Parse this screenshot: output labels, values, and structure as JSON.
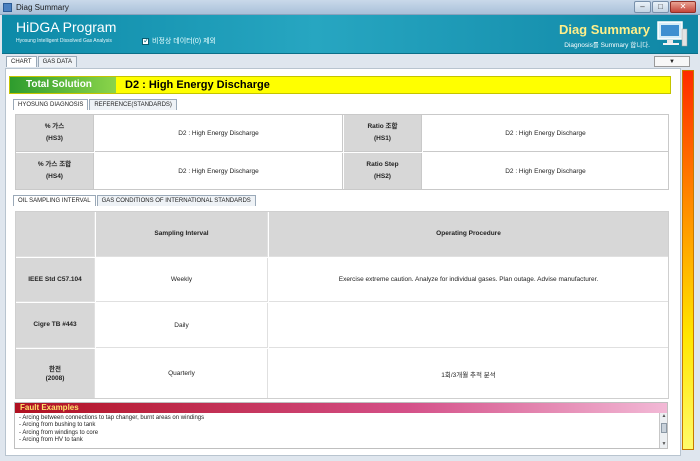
{
  "window": {
    "title": "Diag Summary"
  },
  "header": {
    "brand": "HiDGA Program",
    "brand_sub": "Hyosung Intelligent Dissolved Gas Analysis",
    "checkbox_label": "비정상 데이터(0) 제외",
    "checkbox_checked": true,
    "diag_title": "Diag Summary",
    "diag_sub": "Diagnosis를 Summary 합니다."
  },
  "outer_tabs": [
    {
      "label": "CHART",
      "active": true
    },
    {
      "label": "GAS DATA",
      "active": false
    }
  ],
  "dropdown": {
    "value": "▼"
  },
  "solution": {
    "badge": "Total Solution",
    "text": "D2 : High Energy Discharge"
  },
  "diag_tabs": [
    {
      "label": "HYOSUNG DIAGNOSIS",
      "active": true
    },
    {
      "label": "REFERENCE(STANDARDS)",
      "active": false
    }
  ],
  "diagnosis": [
    {
      "label": "% 가스",
      "code": "(HS3)",
      "value": "D2 : High Energy Discharge"
    },
    {
      "label": "Ratio 조합",
      "code": "(HS1)",
      "value": "D2 : High Energy Discharge"
    },
    {
      "label": "% 가스 조합",
      "code": "(HS4)",
      "value": "D2 : High Energy Discharge"
    },
    {
      "label": "Ratio Step",
      "code": "(HS2)",
      "value": "D2 : High Energy Discharge"
    }
  ],
  "sampling_tabs": [
    {
      "label": "OIL SAMPLING INTERVAL",
      "active": true
    },
    {
      "label": "GAS CONDITIONS OF INTERNATIONAL STANDARDS",
      "active": false
    }
  ],
  "procedure": {
    "headers": [
      "",
      "Sampling Interval",
      "Operating Procedure"
    ],
    "rows": [
      {
        "std": "IEEE Std C57.104",
        "interval": "Weekly",
        "procedure": "Exercise extreme caution. Analyze for individual gases. Plan outage. Advise manufacturer."
      },
      {
        "std": "Cigre TB #443",
        "interval": "Daily",
        "procedure": ""
      },
      {
        "std": "한전\n(2008)",
        "interval": "Quarterly",
        "procedure": "1회/3개월 추적 분석"
      }
    ]
  },
  "fault": {
    "title": "Fault Examples",
    "items": [
      "- Arcing between connections to tap changer, burnt areas on windings",
      "- Arcing from bushing to tank",
      "- Arcing from windings to core",
      "- Arcing from HV to tank"
    ]
  },
  "colors": {
    "header": "#1796b3",
    "solution_bg": "#ffff00",
    "label_gray": "#d7d7d7",
    "fault_head": "#c22a4e"
  }
}
